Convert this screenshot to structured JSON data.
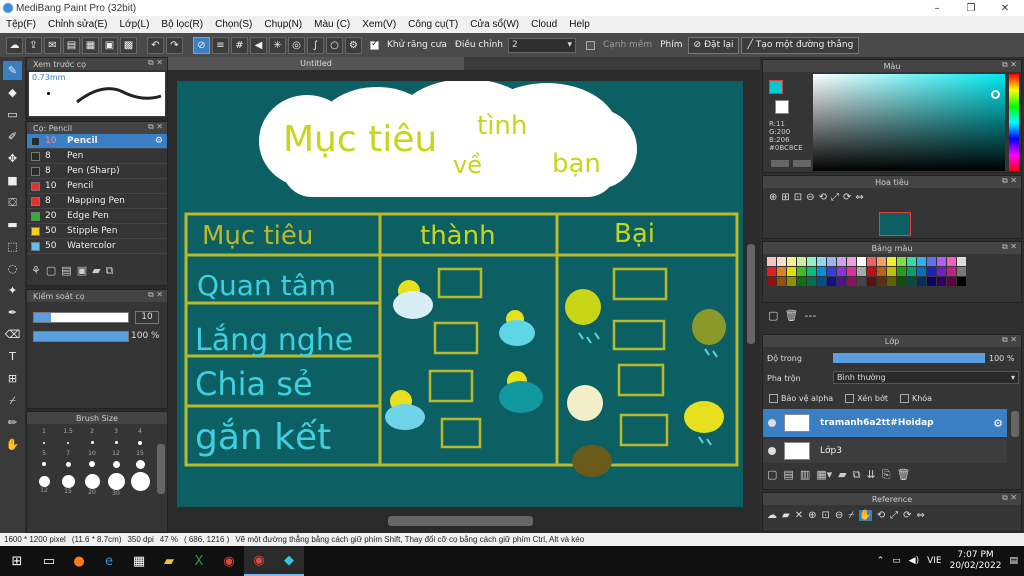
{
  "window": {
    "title": "MediBang Paint Pro (32bit)",
    "minimize": "–",
    "maximize": "❐",
    "close": "✕"
  },
  "menu": [
    "Tệp(F)",
    "Chỉnh sửa(E)",
    "Lớp(L)",
    "Bộ lọc(R)",
    "Chọn(S)",
    "Chụp(N)",
    "Màu (C)",
    "Xem(V)",
    "Công cụ(T)",
    "Cửa sổ(W)",
    "Cloud",
    "Help"
  ],
  "toolbar": {
    "antialias_label": "Khử răng cưa",
    "correction_label": "Điều chỉnh",
    "correction_value": "2",
    "edge_label": "Cạnh mềm",
    "key_label": "Phím",
    "reset_label": "Đặt lại",
    "straight_label": "Tạo một đường thẳng"
  },
  "brush_preview": {
    "title": "Xem trước cọ",
    "size": "0.73mm"
  },
  "brush_panel": {
    "title": "Cọ: Pencil",
    "items": [
      {
        "size": "10",
        "name": "Pencil",
        "color": "#2b2b2b",
        "selected": true
      },
      {
        "size": "8",
        "name": "Pen",
        "color": "#2b2b2b",
        "selected": false
      },
      {
        "size": "8",
        "name": "Pen (Sharp)",
        "color": "#2b2b2b",
        "selected": false
      },
      {
        "size": "10",
        "name": "Pencil",
        "color": "#e03030",
        "selected": false
      },
      {
        "size": "8",
        "name": "Mapping Pen",
        "color": "#e03030",
        "selected": false
      },
      {
        "size": "20",
        "name": "Edge Pen",
        "color": "#30b030",
        "selected": false
      },
      {
        "size": "50",
        "name": "Stipple Pen",
        "color": "#f0d020",
        "selected": false
      },
      {
        "size": "50",
        "name": "Watercolor",
        "color": "#60c0f0",
        "selected": false
      }
    ]
  },
  "brush_control": {
    "title": "Kiểm soát cọ",
    "size_value": "10",
    "opacity_value": "100 %"
  },
  "brush_size": {
    "title": "Brush Size",
    "labels": [
      "1",
      "1.5",
      "2",
      "3",
      "4",
      "5",
      "7",
      "10",
      "12",
      "15",
      "20",
      "30"
    ]
  },
  "canvas": {
    "tab": "Untitled"
  },
  "board": {
    "title_line1": "Mục tiêu",
    "title_line2a": "tình",
    "title_line2b": "về",
    "title_line2c": "bạn",
    "col1": "Mục tiêu",
    "col2": "thành",
    "col3": "Bại",
    "rows": [
      "Quan tâm",
      "Lắng nghe",
      "Chia sẻ",
      "gắn kết"
    ]
  },
  "color_panel": {
    "title": "Màu",
    "r": "R:11",
    "g": "G:200",
    "b": "B:206",
    "hex": "#0BC8CE",
    "accent": "#0BC8CE"
  },
  "navigator": {
    "title": "Hoa tiêu"
  },
  "palette": {
    "title": "Bảng màu",
    "colors": [
      "#f4c4c4",
      "#f4e0c4",
      "#f0f090",
      "#c8f0a0",
      "#90f0c8",
      "#90d8f0",
      "#a0b0f0",
      "#d0a0f0",
      "#f0a0d8",
      "#ffffff",
      "#f06060",
      "#f0a060",
      "#f0f030",
      "#80e040",
      "#30e0a0",
      "#30b0f0",
      "#6070f0",
      "#b060f0",
      "#f060c0",
      "#dddddd",
      "#e02020",
      "#e08020",
      "#e0e000",
      "#40c020",
      "#00c080",
      "#0090e0",
      "#3040e0",
      "#9030e0",
      "#e030a0",
      "#aaaaaa",
      "#c01010",
      "#c06010",
      "#c0c000",
      "#20a010",
      "#00a070",
      "#0070c0",
      "#2020c0",
      "#7020c0",
      "#c02080",
      "#777777",
      "#901010",
      "#905010",
      "#909000",
      "#107010",
      "#007050",
      "#005090",
      "#101090",
      "#501090",
      "#901060",
      "#444444",
      "#601010",
      "#603010",
      "#606000",
      "#105010",
      "#005040",
      "#003060",
      "#100060",
      "#300060",
      "#600040",
      "#000000"
    ]
  },
  "layers": {
    "title": "Lớp",
    "opacity_label": "Độ trong",
    "opacity_value": "100 %",
    "blend_label": "Pha trộn",
    "blend_value": "Bình thường",
    "protect_alpha": "Bảo vệ alpha",
    "clipping": "Xén bớt",
    "lock": "Khóa",
    "items": [
      {
        "name": "tramanh6a2tt#Hoidap",
        "selected": true
      },
      {
        "name": "Lớp3",
        "selected": false
      }
    ]
  },
  "reference": {
    "title": "Reference"
  },
  "status": {
    "size": "1600 * 1200 pixel",
    "dimension": "(11.6 * 8.7cm)",
    "dpi": "350 dpi",
    "zoom": "47 %",
    "coords": "( 686, 1216 )",
    "hint": "Vẽ một đường thẳng bằng cách giữ phím Shift, Thay đổi cỡ cọ bằng cách giữ phím Ctrl, Alt và kéo"
  },
  "taskbar": {
    "lang": "VIE",
    "time": "7:07 PM",
    "date": "20/02/2022"
  }
}
